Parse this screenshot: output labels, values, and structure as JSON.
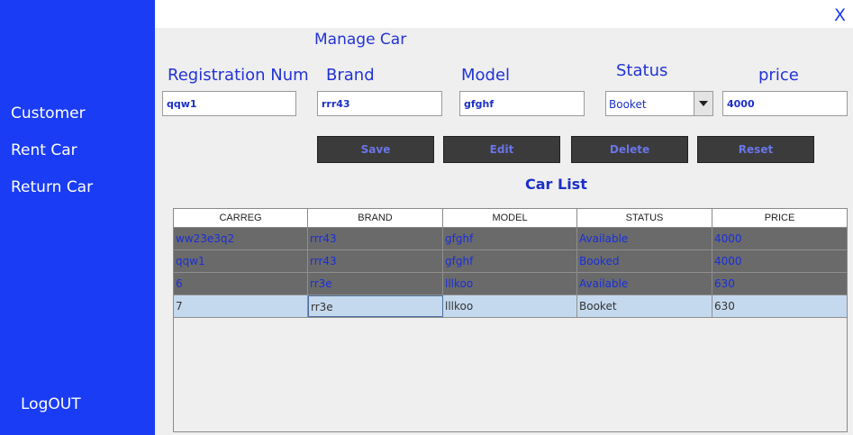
{
  "sidebar": {
    "items": [
      "Customer",
      "Rent Car",
      "Return Car"
    ],
    "logout": "LogOUT"
  },
  "window": {
    "close_label": "X"
  },
  "form": {
    "title": "Manage Car",
    "labels": {
      "registration": "Registration Num",
      "brand": "Brand",
      "model": "Model",
      "status": "Status",
      "price": "price"
    },
    "values": {
      "registration": "qqw1",
      "brand": "rrr43",
      "model": "gfghf",
      "status": "Booket",
      "price": "4000"
    }
  },
  "buttons": {
    "save": "Save",
    "edit": "Edit",
    "delete": "Delete",
    "reset": "Reset"
  },
  "list": {
    "title": "Car List",
    "columns": [
      "CARREG",
      "BRAND",
      "MODEL",
      "STATUS",
      "PRICE"
    ],
    "rows": [
      [
        "ww23e3q2",
        "rrr43",
        "gfghf",
        "Available",
        "4000"
      ],
      [
        "qqw1",
        "rrr43",
        "gfghf",
        "Booked",
        "4000"
      ],
      [
        "6",
        "rr3e",
        "lllkoo",
        "Available",
        "630"
      ],
      [
        "7",
        "rr3e",
        "lllkoo",
        "Booket",
        "630"
      ]
    ]
  },
  "colors": {
    "sidebar": "#1a3cf5",
    "accent_text": "#2233d6",
    "button_bg": "#3b3b3b",
    "row_dark": "#6a6a6a",
    "row_selected": "#c5d9ee"
  }
}
